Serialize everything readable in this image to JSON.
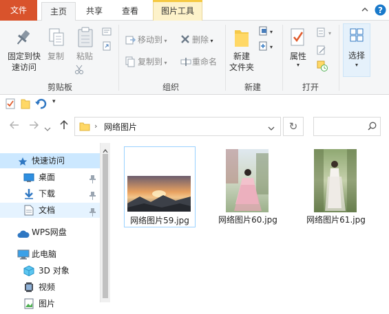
{
  "tabs": {
    "file": "文件",
    "home": "主页",
    "share": "共享",
    "view": "查看",
    "picture_tools": "图片工具"
  },
  "ribbon": {
    "clipboard": {
      "pin_line1": "固定到快",
      "pin_line2": "速访问",
      "copy": "复制",
      "paste": "粘贴",
      "label": "剪贴板"
    },
    "organize": {
      "move_to": "移动到",
      "copy_to": "复制到",
      "delete": "删除",
      "rename": "重命名",
      "label": "组织"
    },
    "new": {
      "new_folder_line1": "新建",
      "new_folder_line2": "文件夹",
      "label": "新建"
    },
    "open": {
      "properties": "属性",
      "label": "打开"
    },
    "select": {
      "select": "选择"
    }
  },
  "address": {
    "path": "网络图片"
  },
  "navigation": [
    {
      "label": "快速访问",
      "icon": "star-icon"
    },
    {
      "label": "桌面",
      "icon": "desktop-icon"
    },
    {
      "label": "下载",
      "icon": "download-icon"
    },
    {
      "label": "文档",
      "icon": "document-icon"
    },
    {
      "label": "WPS网盘",
      "icon": "cloud-icon"
    },
    {
      "label": "此电脑",
      "icon": "computer-icon"
    },
    {
      "label": "3D 对象",
      "icon": "3d-objects-icon"
    },
    {
      "label": "视频",
      "icon": "video-icon"
    },
    {
      "label": "图片",
      "icon": "pictures-icon"
    }
  ],
  "files": [
    {
      "name": "网络图片59.jpg"
    },
    {
      "name": "网络图片60.jpg"
    },
    {
      "name": "网络图片61.jpg"
    }
  ],
  "colors": {
    "file_tab": "#d9532c",
    "selection": "#cce8ff",
    "accent": "#1979ca",
    "picture_tools_tab": "#fdf2ca"
  }
}
